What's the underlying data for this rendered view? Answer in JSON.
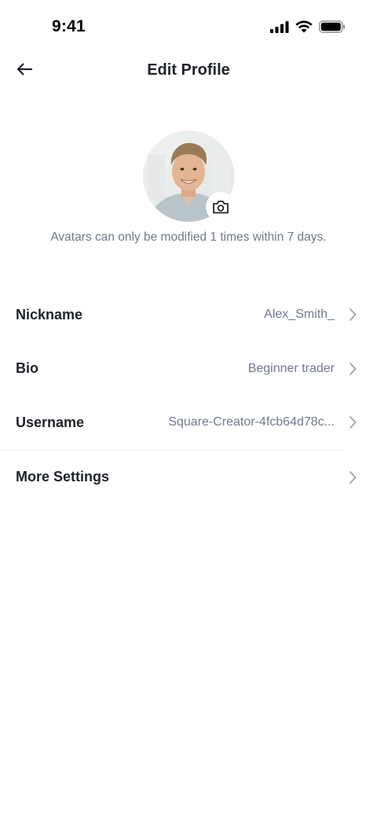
{
  "status_bar": {
    "time": "9:41"
  },
  "header": {
    "title": "Edit Profile",
    "back_icon": "arrow-left-icon"
  },
  "avatar": {
    "hint": "Avatars can only be modified 1 times within 7 days.",
    "edit_icon": "camera-icon"
  },
  "fields": [
    {
      "label": "Nickname",
      "value": "Alex_Smith_"
    },
    {
      "label": "Bio",
      "value": "Beginner trader"
    },
    {
      "label": "Username",
      "value": "Square-Creator-4fcb64d78c..."
    }
  ],
  "more_settings": {
    "label": "More Settings"
  },
  "colors": {
    "text_primary": "#1e2329",
    "text_secondary": "#707a8a",
    "divider": "#eaecef",
    "chevron": "#9aa1ad"
  }
}
